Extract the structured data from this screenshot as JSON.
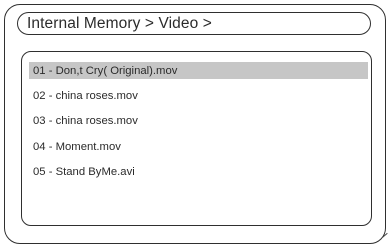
{
  "breadcrumb": {
    "path": "Internal Memory > Video >"
  },
  "file_list": {
    "items": [
      {
        "label": "01 - Don,t Cry( Original).mov",
        "selected": true
      },
      {
        "label": "02 - china roses.mov",
        "selected": false
      },
      {
        "label": "03 - china roses.mov",
        "selected": false
      },
      {
        "label": "04 - Moment.mov",
        "selected": false
      },
      {
        "label": "05 - Stand ByMe.avi",
        "selected": false
      }
    ]
  },
  "colors": {
    "selection_highlight": "#c6c6c6",
    "outline": "#2f2f2f",
    "text": "#2b2b2b"
  }
}
